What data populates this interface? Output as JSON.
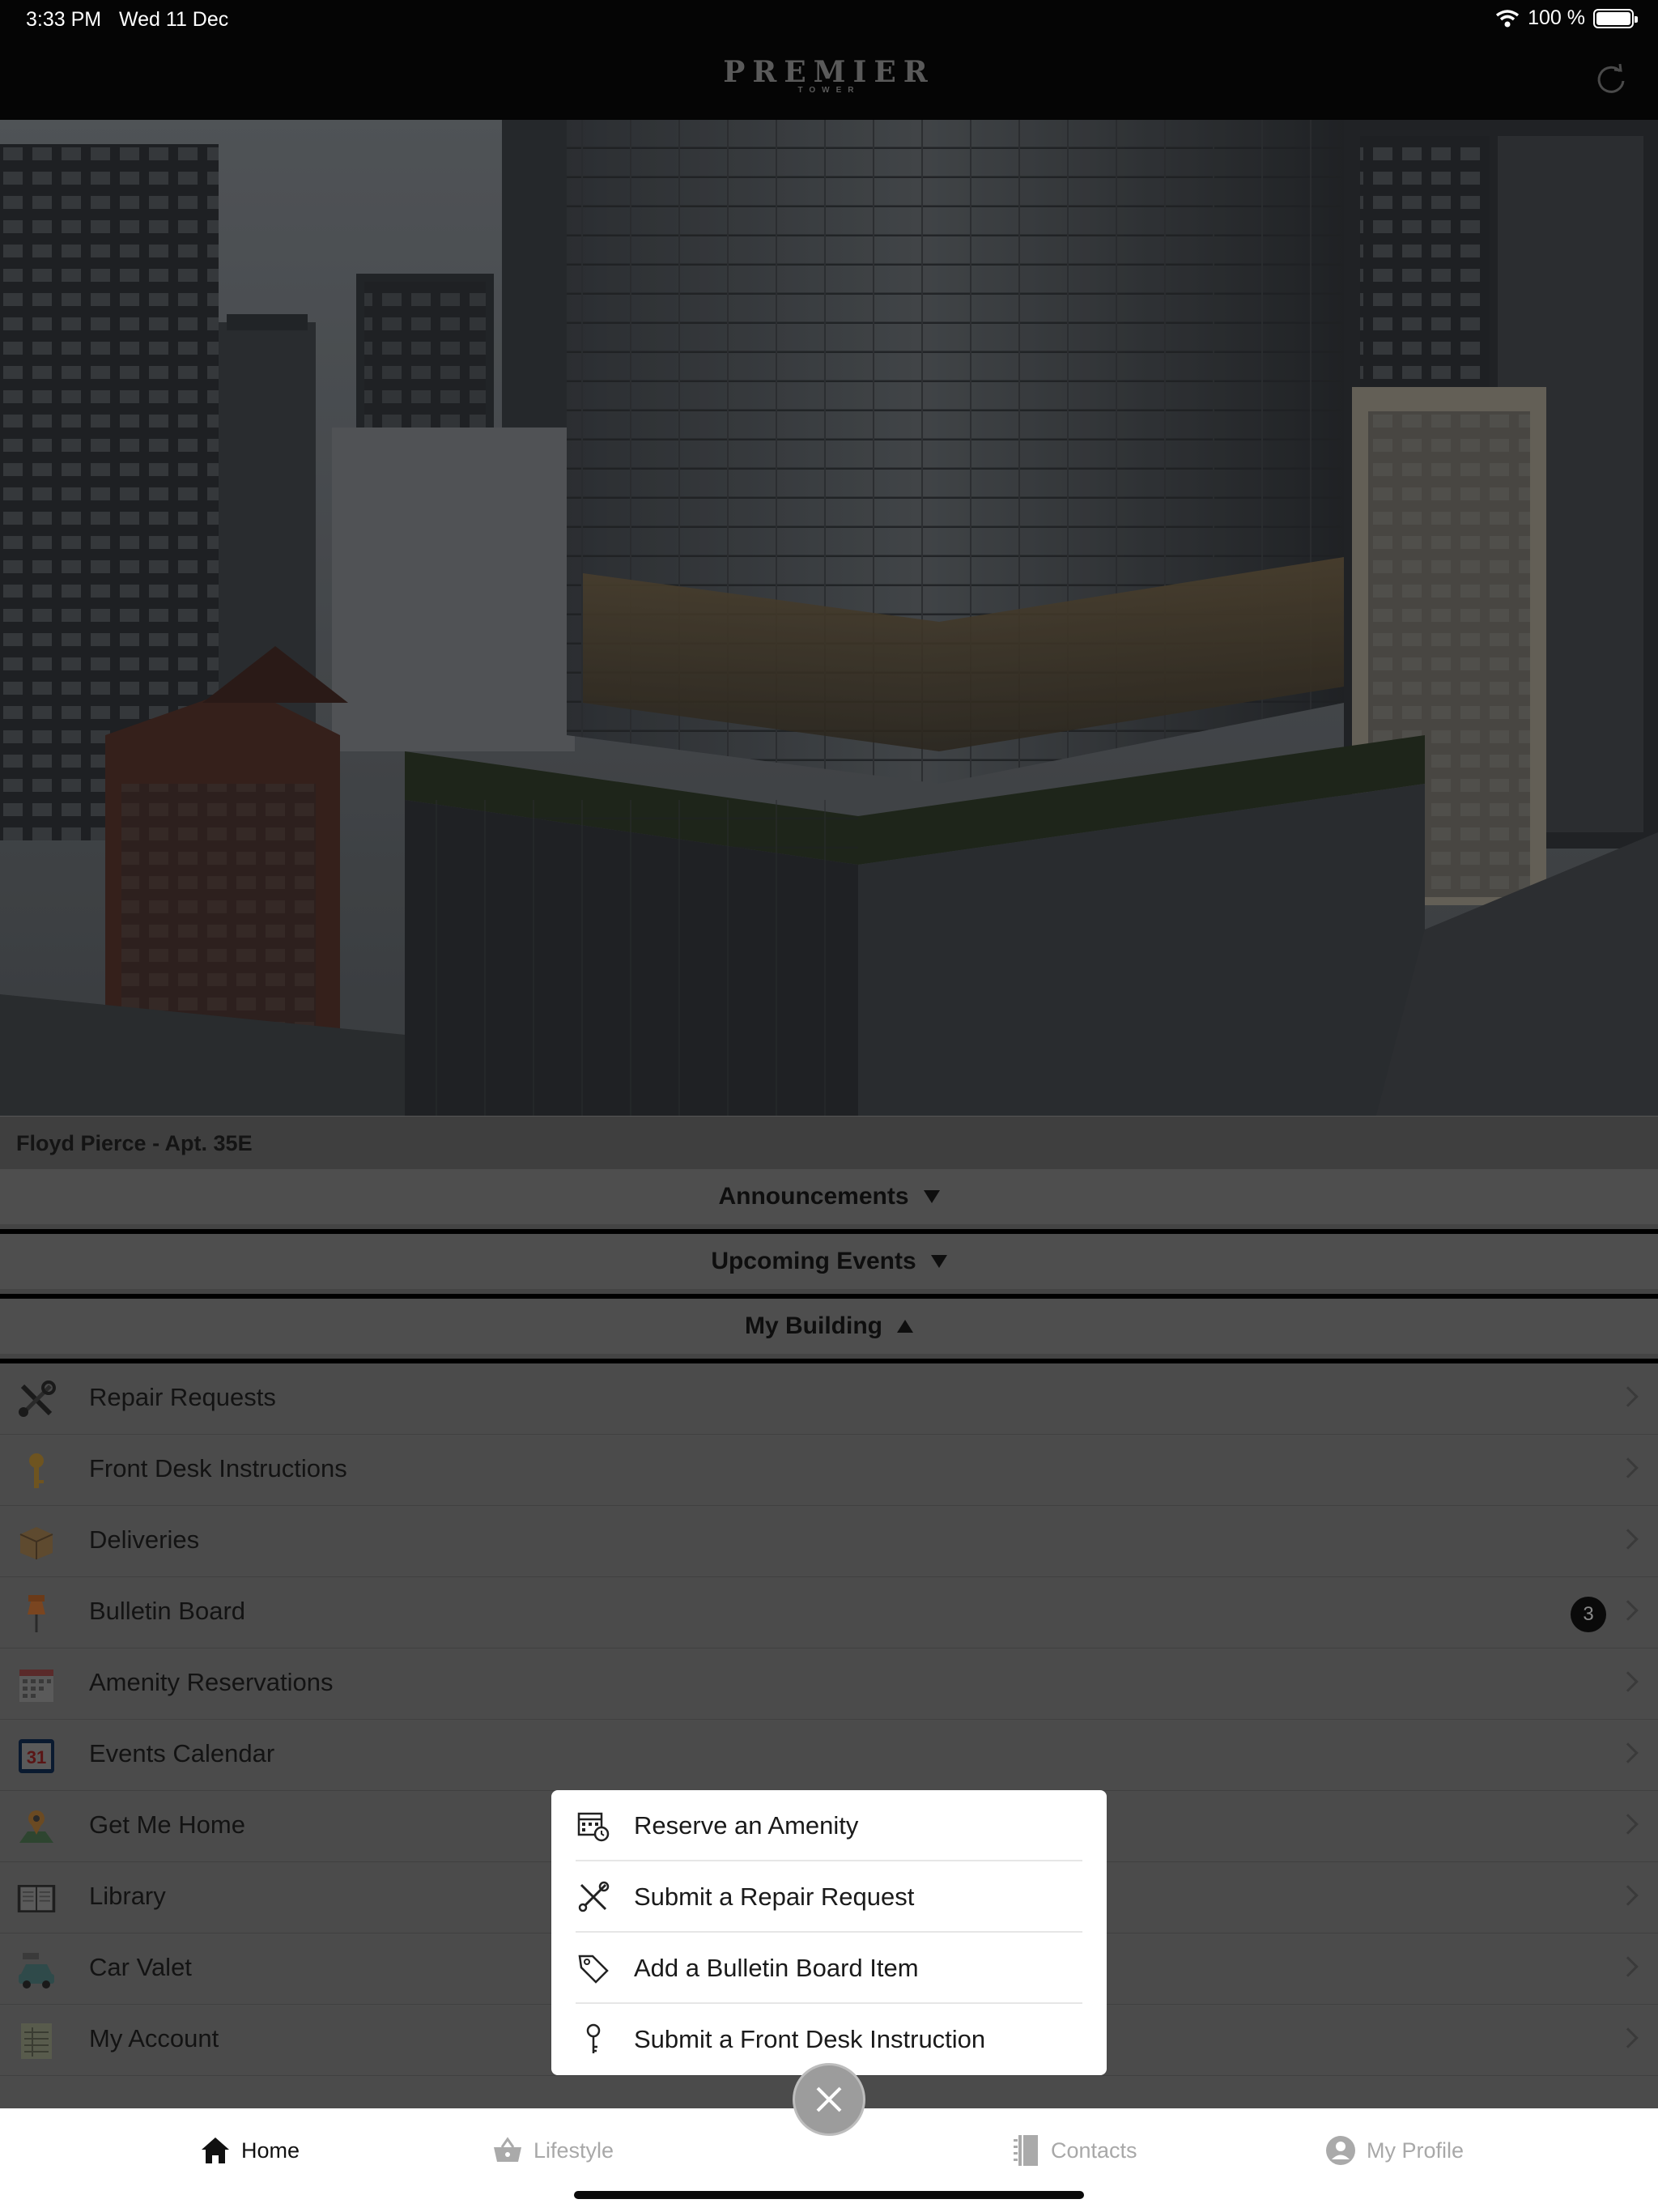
{
  "status_bar": {
    "time": "3:33 PM",
    "date": "Wed 11 Dec",
    "battery": "100 %",
    "battery_level": 1.0
  },
  "header": {
    "logo_main": "PREMIER",
    "logo_sub": "TOWER",
    "refresh_icon": "refresh-icon"
  },
  "user": {
    "name_apt": "Floyd Pierce - Apt. 35E"
  },
  "sections": {
    "announcements": "Announcements",
    "upcoming_events": "Upcoming Events",
    "my_building": "My Building"
  },
  "menu": {
    "items": [
      {
        "label": "Repair Requests",
        "icon": "tools-icon"
      },
      {
        "label": "Front Desk Instructions",
        "icon": "key-icon"
      },
      {
        "label": "Deliveries",
        "icon": "package-icon"
      },
      {
        "label": "Bulletin Board",
        "icon": "pushpin-icon",
        "badge": "3"
      },
      {
        "label": "Amenity Reservations",
        "icon": "calendar-grid-icon"
      },
      {
        "label": "Events Calendar",
        "icon": "calendar-31-icon",
        "icon_text": "31"
      },
      {
        "label": "Get Me Home",
        "icon": "map-pin-icon"
      },
      {
        "label": "Library",
        "icon": "book-icon"
      },
      {
        "label": "Car Valet",
        "icon": "car-icon"
      },
      {
        "label": "My Account",
        "icon": "ledger-icon"
      }
    ]
  },
  "popover": {
    "items": [
      {
        "label": "Reserve an Amenity",
        "icon": "calendar-clock-icon"
      },
      {
        "label": "Submit a Repair Request",
        "icon": "tools-icon"
      },
      {
        "label": "Add a Bulletin Board Item",
        "icon": "tag-icon"
      },
      {
        "label": "Submit a Front Desk Instruction",
        "icon": "key-icon"
      }
    ]
  },
  "tabs": {
    "home": "Home",
    "lifestyle": "Lifestyle",
    "contacts": "Contacts",
    "my_profile": "My Profile"
  },
  "colors": {
    "accent_dark": "#0a0a0a",
    "fab": "#9c9c9c"
  }
}
